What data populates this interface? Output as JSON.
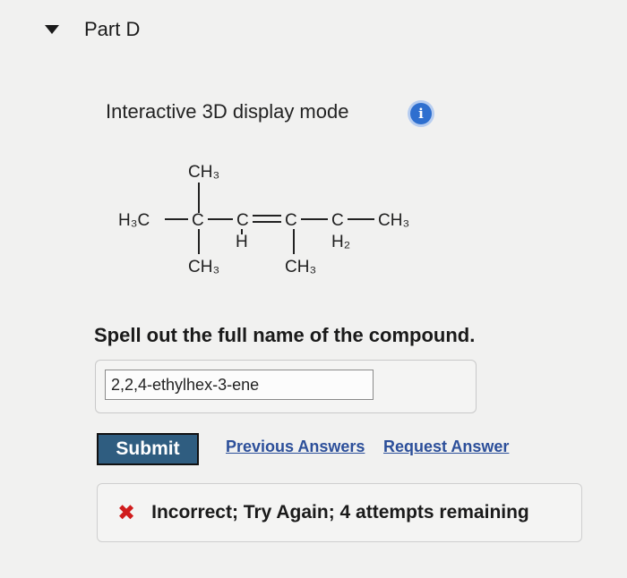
{
  "part": {
    "title": "Part D"
  },
  "display_mode": {
    "label": "Interactive 3D display mode",
    "info_glyph": "i"
  },
  "structure": {
    "h3c": "H₃C",
    "c": "C",
    "ch3": "CH₃",
    "h": "H",
    "h2": "H₂"
  },
  "question": {
    "text": "Spell out the full name of the compound."
  },
  "answer": {
    "value": "2,2,4-ethylhex-3-ene"
  },
  "actions": {
    "submit_label": "Submit",
    "previous_answers_label": "Previous Answers",
    "request_answer_label": "Request Answer"
  },
  "feedback": {
    "icon": "x-icon",
    "text": "Incorrect; Try Again; 4 attempts remaining",
    "color": "#d01c1c"
  }
}
